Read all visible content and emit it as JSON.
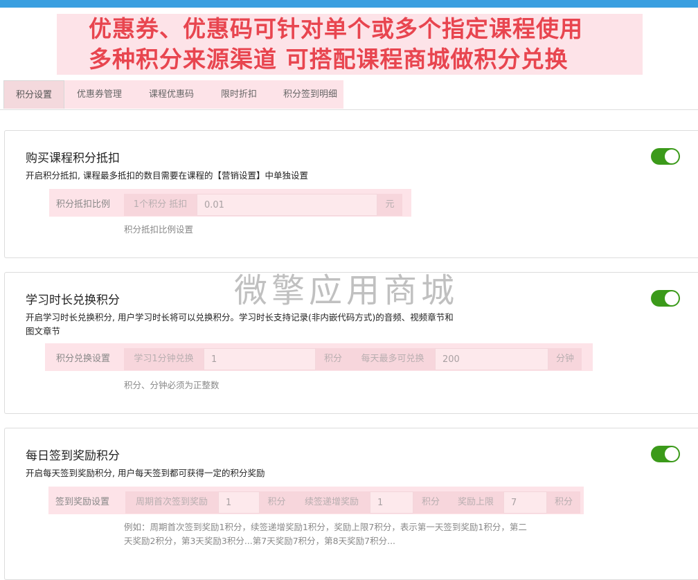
{
  "banner": {
    "line1": "优惠券、优惠码可针对单个或多个指定课程使用",
    "line2": "多种积分来源渠道 可搭配课程商城做积分兑换"
  },
  "tabs": [
    {
      "label": "积分设置",
      "active": true
    },
    {
      "label": "优惠券管理",
      "active": false
    },
    {
      "label": "课程优惠码",
      "active": false
    },
    {
      "label": "限时折扣",
      "active": false
    },
    {
      "label": "积分签到明细",
      "active": false
    }
  ],
  "watermark": "微擎应用商城",
  "sections": {
    "deduction": {
      "title": "购买课程积分抵扣",
      "desc": "开启积分抵扣, 课程最多抵扣的数目需要在课程的【营销设置】中单独设置",
      "enabled": true,
      "label": "积分抵扣比例",
      "prefix": "1个积分 抵扣",
      "value": "0.01",
      "suffix": "元",
      "help": "积分抵扣比例设置"
    },
    "study": {
      "title": "学习时长兑换积分",
      "desc_line1": "开启学习时长兑换积分, 用户学习时长将可以兑换积分。学习时长支持记录(非内嵌代码方式)的音频、视频章节和",
      "desc_line2": "图文章节",
      "enabled": true,
      "label": "积分兑换设置",
      "prefix": "学习1分钟兑换",
      "value": "1",
      "unit1": "积分",
      "max_label": "每天最多可兑换",
      "max_value": "200",
      "unit2": "分钟",
      "help": "积分、分钟必须为正整数"
    },
    "signin": {
      "title": "每日签到奖励积分",
      "desc": "开启每天签到奖励积分, 用户每天签到都可获得一定的积分奖励",
      "enabled": true,
      "label": "签到奖励设置",
      "first_label": "周期首次签到奖励",
      "first_value": "1",
      "unit1": "积分",
      "inc_label": "续签递增奖励",
      "inc_value": "1",
      "unit2": "积分",
      "max_label": "奖励上限",
      "max_value": "7",
      "unit3": "积分",
      "help_line1": "例如：周期首次签到奖励1积分，续签递增奖励1积分，奖励上限7积分，表示第一天签到奖励1积分，第二",
      "help_line2": "天奖励2积分，第3天奖励3积分...第7天奖励7积分，第8天奖励7积分..."
    }
  },
  "colors": {
    "topbar": "#3a9fe0",
    "banner_bg": "#fde3e8",
    "banner_text": "#e8454f",
    "toggle_on": "#3b9a1a"
  }
}
